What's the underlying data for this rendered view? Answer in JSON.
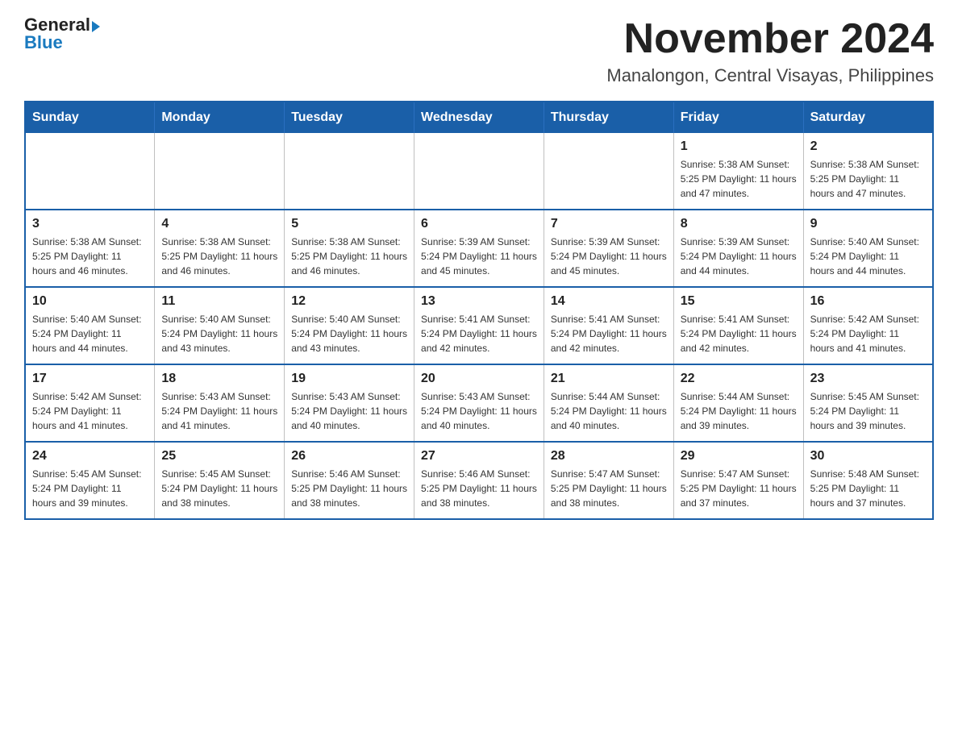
{
  "header": {
    "logo_general": "General",
    "logo_blue": "Blue",
    "month_title": "November 2024",
    "location": "Manalongon, Central Visayas, Philippines"
  },
  "days_of_week": [
    "Sunday",
    "Monday",
    "Tuesday",
    "Wednesday",
    "Thursday",
    "Friday",
    "Saturday"
  ],
  "weeks": [
    [
      {
        "day": "",
        "info": ""
      },
      {
        "day": "",
        "info": ""
      },
      {
        "day": "",
        "info": ""
      },
      {
        "day": "",
        "info": ""
      },
      {
        "day": "",
        "info": ""
      },
      {
        "day": "1",
        "info": "Sunrise: 5:38 AM\nSunset: 5:25 PM\nDaylight: 11 hours and 47 minutes."
      },
      {
        "day": "2",
        "info": "Sunrise: 5:38 AM\nSunset: 5:25 PM\nDaylight: 11 hours and 47 minutes."
      }
    ],
    [
      {
        "day": "3",
        "info": "Sunrise: 5:38 AM\nSunset: 5:25 PM\nDaylight: 11 hours and 46 minutes."
      },
      {
        "day": "4",
        "info": "Sunrise: 5:38 AM\nSunset: 5:25 PM\nDaylight: 11 hours and 46 minutes."
      },
      {
        "day": "5",
        "info": "Sunrise: 5:38 AM\nSunset: 5:25 PM\nDaylight: 11 hours and 46 minutes."
      },
      {
        "day": "6",
        "info": "Sunrise: 5:39 AM\nSunset: 5:24 PM\nDaylight: 11 hours and 45 minutes."
      },
      {
        "day": "7",
        "info": "Sunrise: 5:39 AM\nSunset: 5:24 PM\nDaylight: 11 hours and 45 minutes."
      },
      {
        "day": "8",
        "info": "Sunrise: 5:39 AM\nSunset: 5:24 PM\nDaylight: 11 hours and 44 minutes."
      },
      {
        "day": "9",
        "info": "Sunrise: 5:40 AM\nSunset: 5:24 PM\nDaylight: 11 hours and 44 minutes."
      }
    ],
    [
      {
        "day": "10",
        "info": "Sunrise: 5:40 AM\nSunset: 5:24 PM\nDaylight: 11 hours and 44 minutes."
      },
      {
        "day": "11",
        "info": "Sunrise: 5:40 AM\nSunset: 5:24 PM\nDaylight: 11 hours and 43 minutes."
      },
      {
        "day": "12",
        "info": "Sunrise: 5:40 AM\nSunset: 5:24 PM\nDaylight: 11 hours and 43 minutes."
      },
      {
        "day": "13",
        "info": "Sunrise: 5:41 AM\nSunset: 5:24 PM\nDaylight: 11 hours and 42 minutes."
      },
      {
        "day": "14",
        "info": "Sunrise: 5:41 AM\nSunset: 5:24 PM\nDaylight: 11 hours and 42 minutes."
      },
      {
        "day": "15",
        "info": "Sunrise: 5:41 AM\nSunset: 5:24 PM\nDaylight: 11 hours and 42 minutes."
      },
      {
        "day": "16",
        "info": "Sunrise: 5:42 AM\nSunset: 5:24 PM\nDaylight: 11 hours and 41 minutes."
      }
    ],
    [
      {
        "day": "17",
        "info": "Sunrise: 5:42 AM\nSunset: 5:24 PM\nDaylight: 11 hours and 41 minutes."
      },
      {
        "day": "18",
        "info": "Sunrise: 5:43 AM\nSunset: 5:24 PM\nDaylight: 11 hours and 41 minutes."
      },
      {
        "day": "19",
        "info": "Sunrise: 5:43 AM\nSunset: 5:24 PM\nDaylight: 11 hours and 40 minutes."
      },
      {
        "day": "20",
        "info": "Sunrise: 5:43 AM\nSunset: 5:24 PM\nDaylight: 11 hours and 40 minutes."
      },
      {
        "day": "21",
        "info": "Sunrise: 5:44 AM\nSunset: 5:24 PM\nDaylight: 11 hours and 40 minutes."
      },
      {
        "day": "22",
        "info": "Sunrise: 5:44 AM\nSunset: 5:24 PM\nDaylight: 11 hours and 39 minutes."
      },
      {
        "day": "23",
        "info": "Sunrise: 5:45 AM\nSunset: 5:24 PM\nDaylight: 11 hours and 39 minutes."
      }
    ],
    [
      {
        "day": "24",
        "info": "Sunrise: 5:45 AM\nSunset: 5:24 PM\nDaylight: 11 hours and 39 minutes."
      },
      {
        "day": "25",
        "info": "Sunrise: 5:45 AM\nSunset: 5:24 PM\nDaylight: 11 hours and 38 minutes."
      },
      {
        "day": "26",
        "info": "Sunrise: 5:46 AM\nSunset: 5:25 PM\nDaylight: 11 hours and 38 minutes."
      },
      {
        "day": "27",
        "info": "Sunrise: 5:46 AM\nSunset: 5:25 PM\nDaylight: 11 hours and 38 minutes."
      },
      {
        "day": "28",
        "info": "Sunrise: 5:47 AM\nSunset: 5:25 PM\nDaylight: 11 hours and 38 minutes."
      },
      {
        "day": "29",
        "info": "Sunrise: 5:47 AM\nSunset: 5:25 PM\nDaylight: 11 hours and 37 minutes."
      },
      {
        "day": "30",
        "info": "Sunrise: 5:48 AM\nSunset: 5:25 PM\nDaylight: 11 hours and 37 minutes."
      }
    ]
  ]
}
